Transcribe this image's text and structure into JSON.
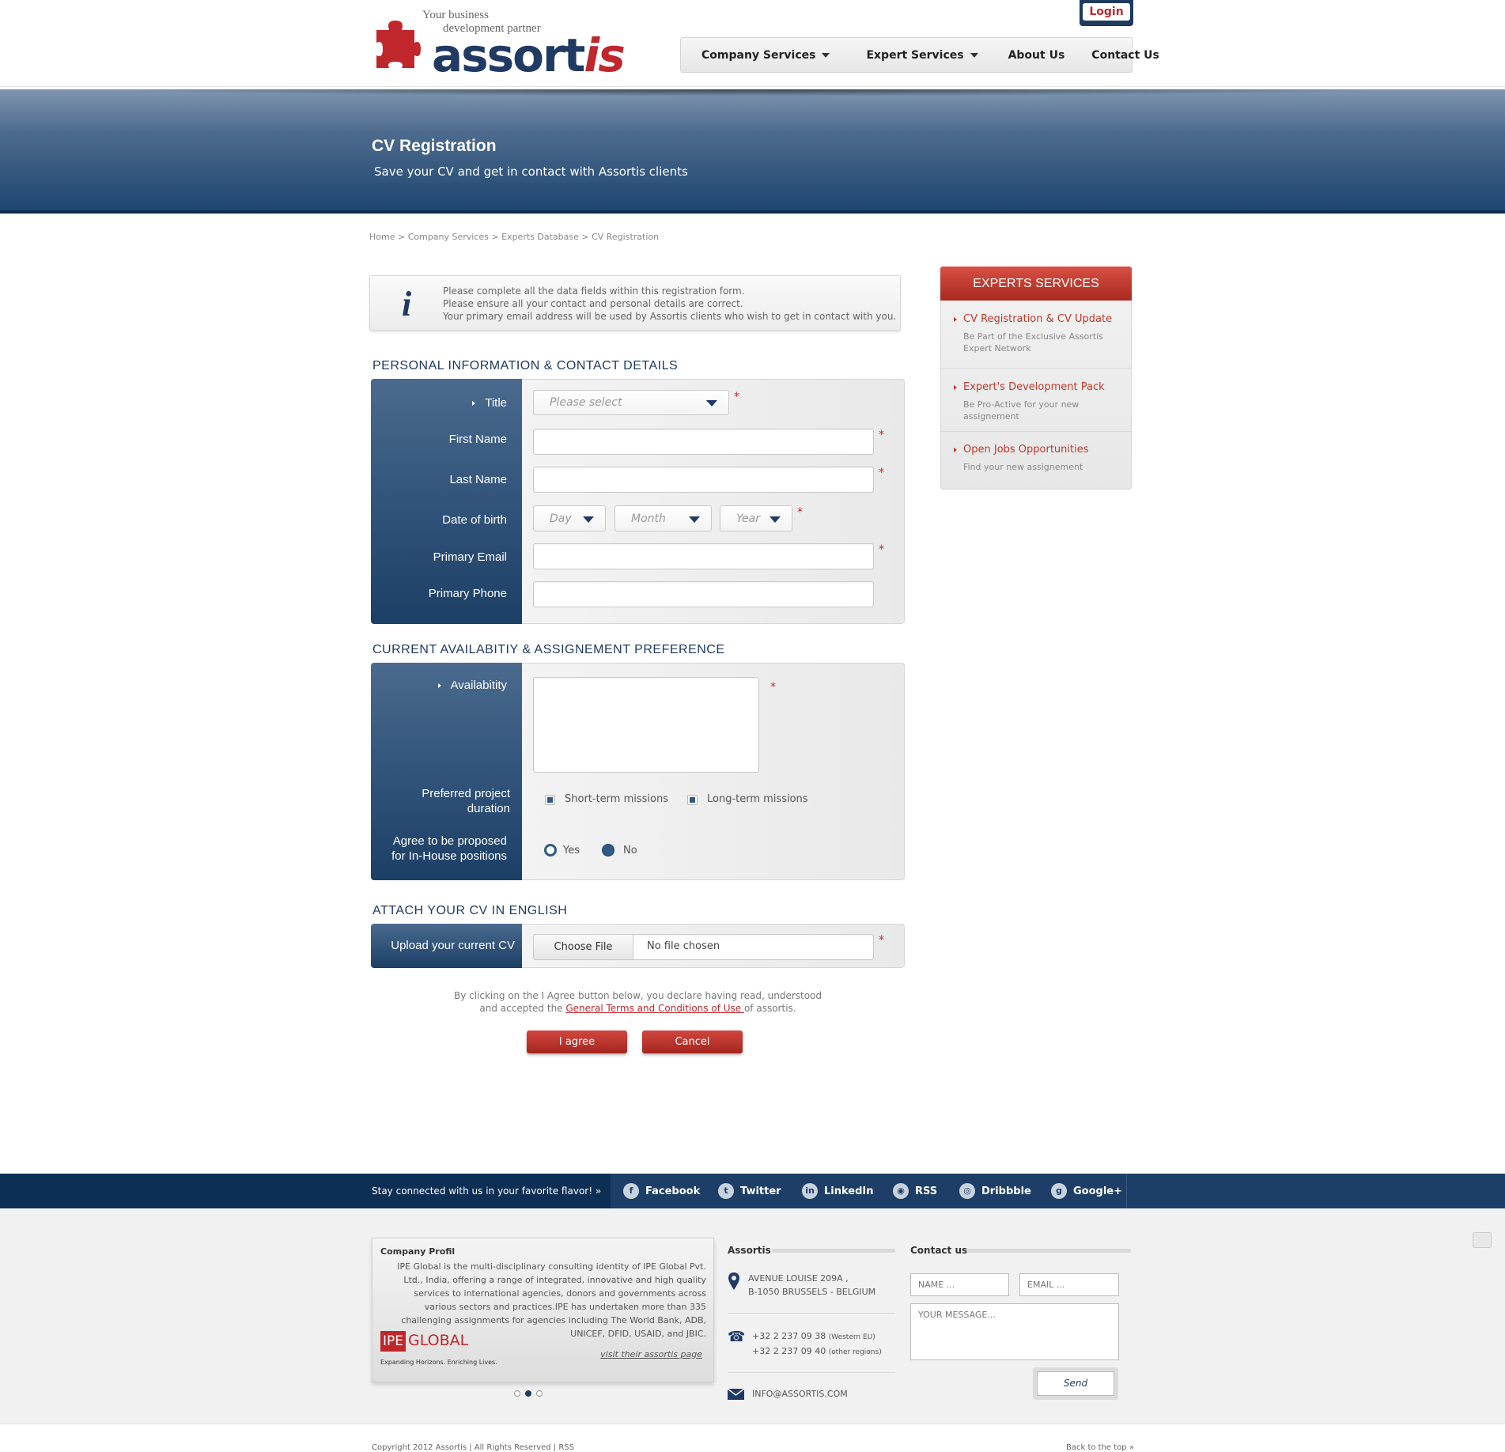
{
  "header": {
    "tagline_line1": "Your business",
    "tagline_line2": "development partner",
    "logo_text_a": "assort",
    "logo_text_b": "is",
    "login": "Login",
    "nav": [
      "Company Services",
      "Expert Services",
      "About Us",
      "Contact Us"
    ]
  },
  "banner": {
    "title": "CV Registration",
    "subtitle": "Save your CV and get in contact with Assortis clients"
  },
  "breadcrumb": "Home > Company Services > Experts Database > CV Registration",
  "info": {
    "icon": "i",
    "line1": "Please complete all the data fields within this registration form.",
    "line2": "Please ensure all your contact and personal details are correct.",
    "line3": "Your primary email address will be used by Assortis clients who wish to get in contact with you."
  },
  "personal": {
    "title": "PERSONAL INFORMATION & CONTACT DETAILS",
    "labels": {
      "title": "Title",
      "first_name": "First Name",
      "last_name": "Last Name",
      "dob": "Date of birth",
      "email": "Primary Email",
      "phone": "Primary Phone"
    },
    "title_placeholder": "Please select",
    "day": "Day",
    "month": "Month",
    "year": "Year",
    "required": "*"
  },
  "availability": {
    "title": "CURRENT AVAILABITIY & ASSIGNEMENT PREFERENCE",
    "label_availability": "Availabitity",
    "label_duration_1": "Preferred project",
    "label_duration_2": "duration",
    "opt_short": "Short-term missions",
    "opt_long": "Long-term missions",
    "label_inhouse_1": "Agree to be proposed",
    "label_inhouse_2": "for In-House positions",
    "yes": "Yes",
    "no": "No",
    "short_checked": true,
    "long_checked": true,
    "inhouse_selected": "No"
  },
  "attach": {
    "title": "ATTACH YOUR CV IN ENGLISH",
    "label": "Upload your current CV",
    "choose": "Choose File",
    "no_file": "No file chosen"
  },
  "terms": {
    "line1": "By clicking on the I Agree button below, you declare having read, understood",
    "line2_a": "and accepted the ",
    "line2_link": "General Terms and Conditions of Use ",
    "line2_b": "of assortis."
  },
  "buttons": {
    "agree": "I agree",
    "cancel": "Cancel"
  },
  "sidebar": {
    "title": "EXPERTS SERVICES",
    "items": [
      {
        "title": "CV Registration & CV Update",
        "desc1": "Be Part of the Exclusive Assortis",
        "desc2": "Expert Network"
      },
      {
        "title": "Expert's Development Pack",
        "desc1": "Be Pro-Active for your new",
        "desc2": "assignement"
      },
      {
        "title": "Open Jobs Opportunities",
        "desc1": "Find your new assignement",
        "desc2": ""
      }
    ]
  },
  "social": {
    "stay": "Stay connected with us in your favorite flavor!  »",
    "items": [
      "Facebook",
      "Twitter",
      "LinkedIn",
      "RSS",
      "Dribbble",
      "Google+"
    ]
  },
  "footer": {
    "profile_title": "Company Profil",
    "profile_text": "IPE Global is the multi-disciplinary consulting identity of IPE Global Pvt. Ltd., India, offering a range of integrated, innovative and high quality services to international agencies, donors and governments across various sectors and practices.IPE has undertaken more than 335 challenging assignments for agencies including The World Bank, ADB, UNICEF, DFID, USAID, and JBIC.",
    "ipe_logo_a": "IPE",
    "ipe_logo_b": "GLOBAL",
    "ipe_slogan": "Expanding Horizons. Enriching Lives.",
    "profile_link": "visit their assortis page",
    "assortis_title": "Assortis",
    "address1": "AVENUE LOUISE 209A ,",
    "address2": "B-1050 BRUSSELS - BELGIUM",
    "phone1": "+32 2 237 09 38",
    "phone1_note": "(Western EU)",
    "phone2": "+32 2 237 09 40",
    "phone2_note": "(other regions)",
    "email": "INFO@ASSORTIS.COM",
    "contact_title": "Contact us",
    "name_placeholder": "NAME ...",
    "email_placeholder": "EMAIL ...",
    "message_placeholder": "YOUR MESSAGE...",
    "send": "Send"
  },
  "bottom": {
    "copyright": "Copyright 2012 Assortis  |  All Rights Reserved  |  RSS",
    "back_top": "Back to the top  »"
  },
  "colors": {
    "navy": "#1f3a63",
    "red": "#c0272d",
    "banner_dark": "#1e4670"
  }
}
